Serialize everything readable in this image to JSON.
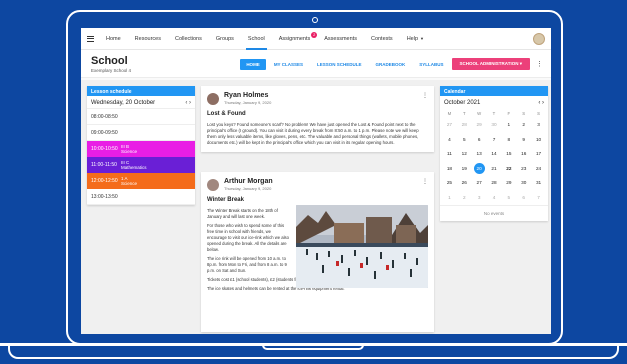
{
  "nav": {
    "items": [
      "Home",
      "Resources",
      "Collections",
      "Groups",
      "School",
      "Assignments",
      "Assessments",
      "Contests",
      "Help"
    ],
    "assignments_badge": "2"
  },
  "school": {
    "title": "School",
    "subtitle": "Exemplary School 4",
    "tabs": [
      "HOME",
      "MY CLASSES",
      "LESSON SCHEDULE",
      "GRADEBOOK",
      "SYLLABUS"
    ],
    "admin_label": "SCHOOL ADMINISTRATION"
  },
  "schedule": {
    "title": "Lesson schedule",
    "date": "Wednesday, 20 October",
    "slots": [
      {
        "time": "08:00-08:50",
        "info": "",
        "color": ""
      },
      {
        "time": "09:00-09:50",
        "info": "",
        "color": ""
      },
      {
        "time": "10:00-10:50",
        "info": "III B\nScience",
        "color": "#e91ee5"
      },
      {
        "time": "11:00-11:50",
        "info": "III C\nMathematics",
        "color": "#6a1fd6"
      },
      {
        "time": "12:00-12:50",
        "info": "1 A\nScience",
        "color": "#f46c1b"
      },
      {
        "time": "13:00-13:50",
        "info": "",
        "color": ""
      }
    ]
  },
  "post1": {
    "author": "Ryan Holmes",
    "date": "Thursday, January 9, 2020",
    "title": "Lost & Found",
    "body": "Lost you keys? Found someone's scarf? No problem! We have just opened the Lost & Found point next to the principal's office (I ground). You can visit it during every break from 8:50 a.m. to 1 p.m. Please note we will keep them only less valuable items, like gloves, pens, etc. The valuable and personal things (wallets, mobile phones, documents etc.) will be kept in the principal's office which you can visit in its regular opening hours."
  },
  "post2": {
    "author": "Arthur Morgan",
    "date": "Thursday, January 9, 2020",
    "title": "Winter Break",
    "paragraphs": [
      "The Winter Break starts on the 18th of January and will last one week.",
      "For those who wish to spend some of this free time in school with friends, we encourage to visit our ice-rink which we also opened during the break. All the details are below.",
      "The ice rink will be opened from 10 a.m. to 8p.m. from Mon to Fri, and from 8 a.m. to 9 p.m. on Sat and Sun.",
      "Tickets cost £1 (school students), £2 (students from other schools), £4 (adults).",
      "The ice skates and helmets can be rented at the ice-rink equipment rental."
    ]
  },
  "calendar": {
    "title": "Calendar",
    "month": "October 2021",
    "dow": [
      "M",
      "T",
      "W",
      "T",
      "F",
      "S",
      "S"
    ],
    "days": [
      {
        "d": "27",
        "dim": true
      },
      {
        "d": "28",
        "dim": true
      },
      {
        "d": "29",
        "dim": true
      },
      {
        "d": "30",
        "dim": true
      },
      {
        "d": "1"
      },
      {
        "d": "2"
      },
      {
        "d": "3"
      },
      {
        "d": "4"
      },
      {
        "d": "5"
      },
      {
        "d": "6"
      },
      {
        "d": "7"
      },
      {
        "d": "8"
      },
      {
        "d": "9"
      },
      {
        "d": "10"
      },
      {
        "d": "11"
      },
      {
        "d": "12"
      },
      {
        "d": "13"
      },
      {
        "d": "14"
      },
      {
        "d": "15"
      },
      {
        "d": "16"
      },
      {
        "d": "17"
      },
      {
        "d": "18"
      },
      {
        "d": "19"
      },
      {
        "d": "20",
        "today": true
      },
      {
        "d": "21"
      },
      {
        "d": "22",
        "bold": true
      },
      {
        "d": "23"
      },
      {
        "d": "24"
      },
      {
        "d": "25"
      },
      {
        "d": "26"
      },
      {
        "d": "27"
      },
      {
        "d": "28"
      },
      {
        "d": "29"
      },
      {
        "d": "30"
      },
      {
        "d": "31"
      },
      {
        "d": "1",
        "dim": true
      },
      {
        "d": "2",
        "dim": true
      },
      {
        "d": "3",
        "dim": true
      },
      {
        "d": "4",
        "dim": true
      },
      {
        "d": "5",
        "dim": true
      },
      {
        "d": "6",
        "dim": true
      },
      {
        "d": "7",
        "dim": true
      }
    ],
    "footer": "No events"
  }
}
